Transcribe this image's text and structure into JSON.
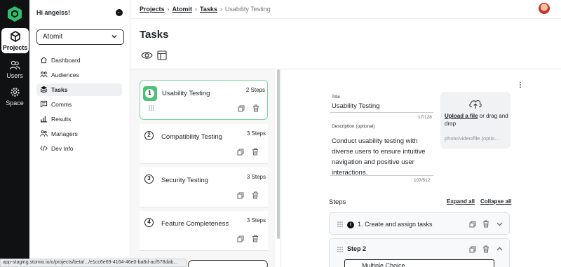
{
  "rail": {
    "items": [
      {
        "label": "Projects",
        "icon": "cube-icon",
        "active": true
      },
      {
        "label": "Users",
        "icon": "users-icon",
        "active": false
      },
      {
        "label": "Space",
        "icon": "gear-icon",
        "active": false
      }
    ]
  },
  "sidebar": {
    "greeting": "Hi angelss!",
    "org": "Atomit",
    "items": [
      {
        "label": "Dashboard",
        "icon": "home-icon"
      },
      {
        "label": "Audiences",
        "icon": "audiences-icon"
      },
      {
        "label": "Tasks",
        "icon": "layers-icon"
      },
      {
        "label": "Comms",
        "icon": "chat-icon"
      },
      {
        "label": "Results",
        "icon": "bar-chart-icon"
      },
      {
        "label": "Managers",
        "icon": "managers-icon"
      },
      {
        "label": "Dev Info",
        "icon": "code-icon"
      }
    ]
  },
  "breadcrumb": {
    "items": [
      "Projects",
      "Atomit",
      "Tasks"
    ],
    "current": "Usability Testing"
  },
  "page": {
    "title": "Tasks"
  },
  "tasks": [
    {
      "num": "1",
      "name": "Usability Testing",
      "steps": "2 Steps"
    },
    {
      "num": "2",
      "name": "Compatibility Testing",
      "steps": "3 Steps"
    },
    {
      "num": "3",
      "name": "Security Testing",
      "steps": "3 Steps"
    },
    {
      "num": "4",
      "name": "Feature Completeness",
      "steps": "3 Steps"
    }
  ],
  "editor": {
    "title_label": "Title",
    "title_value": "Usability Testing",
    "title_counter": "17/128",
    "desc_label": "Description (optional)",
    "desc_value": "Conduct usability testing with diverse users to ensure intuitive navigation and positive user interactions.",
    "desc_counter": "107/512",
    "upload_link": "Upload a file",
    "upload_rest": " or drag and drop",
    "upload_hint": "photo/video/file (optio...",
    "steps_title": "Steps",
    "expand_all": "Expand all",
    "collapse_all": "Collapse all",
    "step1": "1. Create and assign tasks",
    "step2": "Step 2",
    "step2_type": "Multiple Choice"
  },
  "statusbar": {
    "url": "app-staging.stomio.io/o/projects/beta/.../e1cc6e69-4164-46e0-ba8d-acf578dab..."
  },
  "colors": {
    "accent": "#4cc27a",
    "rail_bg": "#0f1113"
  }
}
